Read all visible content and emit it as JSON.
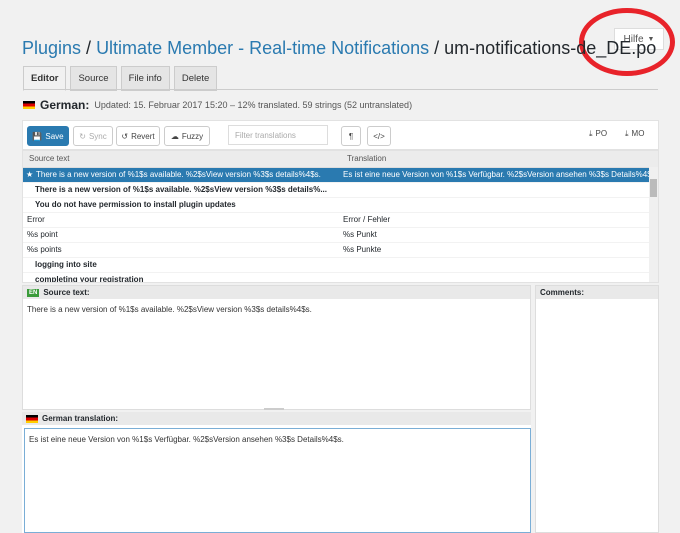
{
  "help": {
    "label": "Hilfe",
    "caret": "▼"
  },
  "title": {
    "crumb1": "Plugins",
    "sep": " / ",
    "crumb2": "Ultimate Member - Real-time Notifications",
    "file": "um-notifications-de_DE.po"
  },
  "tabs": [
    "Editor",
    "Source",
    "File info",
    "Delete"
  ],
  "status": {
    "lang": "German:",
    "text": "Updated: 15. Februar 2017 15:20 – 12% translated. 59 strings (52 untranslated)"
  },
  "toolbar": {
    "save": "Save",
    "sync": "Sync",
    "revert": "Revert",
    "fuzzy": "Fuzzy",
    "filter_placeholder": "Filter translations",
    "po": "PO",
    "mo": "MO"
  },
  "grid": {
    "header_source": "Source text",
    "header_translation": "Translation",
    "rows": [
      {
        "source": "There is a new version of %1$s available. %2$sView version %3$s details%4$s.",
        "translation": "Es ist eine neue Version von %1$s Verfügbar. %2$sVersion ansehen %3$s Details%4$s."
      },
      {
        "source": "There is a new version of %1$s available. %2$sView version %3$s details%...",
        "translation": ""
      },
      {
        "source": "You do not have permission to install plugin updates",
        "translation": ""
      },
      {
        "source": "Error",
        "translation": "Error / Fehler"
      },
      {
        "source": "%s point",
        "translation": "%s Punkt"
      },
      {
        "source": "%s points",
        "translation": "%s Punkte"
      },
      {
        "source": "logging into site",
        "translation": ""
      },
      {
        "source": "completing your registration",
        "translation": ""
      }
    ]
  },
  "source_pane": {
    "flag": "EN",
    "label": "Source text:",
    "text": "There is a new version of %1$s available. %2$sView version %3$s details%4$s."
  },
  "comments_pane": {
    "label": "Comments:"
  },
  "translation_pane": {
    "label": "German translation:",
    "text": "Es ist eine neue Version von %1$s Verfügbar. %2$sVersion ansehen %3$s Details%4$s."
  },
  "colors": {
    "accent": "#2a7ab0",
    "highlight": "#e8232a"
  }
}
